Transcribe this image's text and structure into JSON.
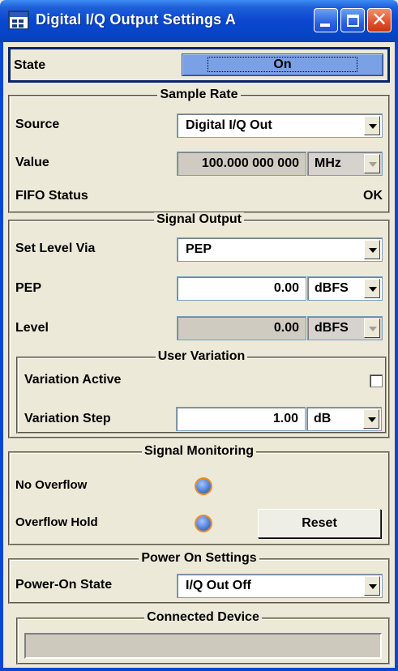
{
  "window": {
    "title": "Digital I/Q Output Settings  A"
  },
  "state": {
    "label": "State",
    "button": "On"
  },
  "sample_rate": {
    "title": "Sample Rate",
    "source_label": "Source",
    "source_value": "Digital I/Q Out",
    "value_label": "Value",
    "value": "100.000 000 000",
    "value_unit": "MHz",
    "fifo_label": "FIFO Status",
    "fifo_value": "OK"
  },
  "signal_output": {
    "title": "Signal Output",
    "set_level_label": "Set Level Via",
    "set_level_value": "PEP",
    "pep_label": "PEP",
    "pep_value": "0.00",
    "pep_unit": "dBFS",
    "level_label": "Level",
    "level_value": "0.00",
    "level_unit": "dBFS"
  },
  "user_variation": {
    "title": "User Variation",
    "active_label": "Variation Active",
    "step_label": "Variation Step",
    "step_value": "1.00",
    "step_unit": "dB"
  },
  "signal_monitoring": {
    "title": "Signal Monitoring",
    "no_overflow_label": "No Overflow",
    "overflow_hold_label": "Overflow Hold",
    "reset_label": "Reset"
  },
  "power_on": {
    "title": "Power On Settings",
    "state_label": "Power-On State",
    "state_value": "I/Q Out Off"
  },
  "connected_device": {
    "title": "Connected Device"
  }
}
